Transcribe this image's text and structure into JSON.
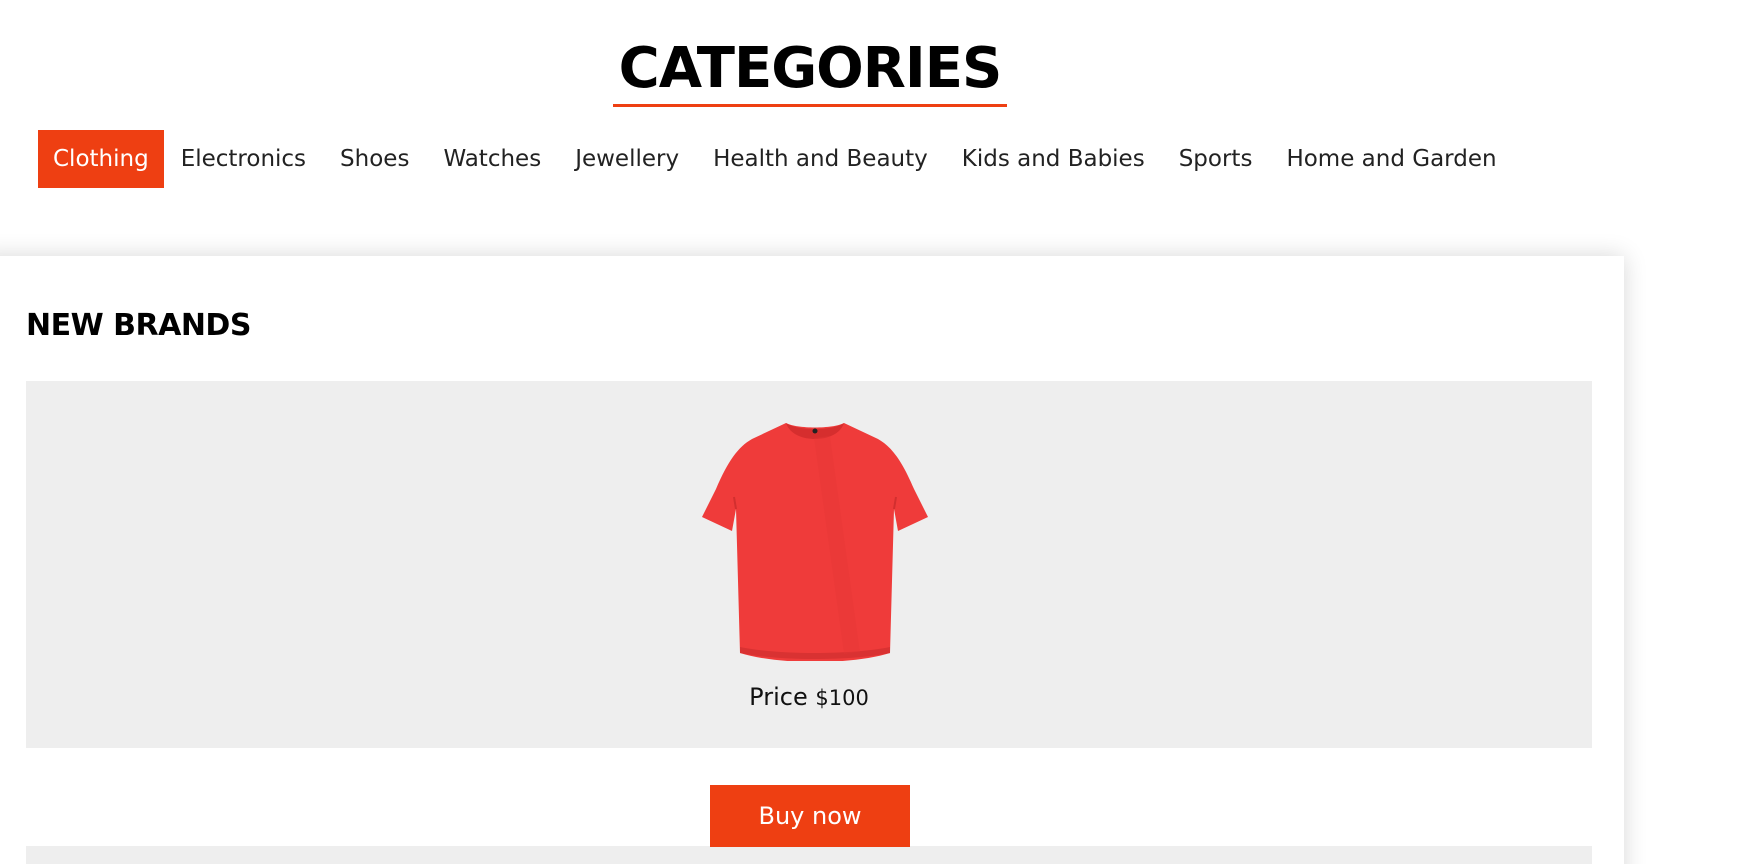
{
  "header": {
    "title": "CATEGORIES"
  },
  "categories": {
    "active_index": 0,
    "items": [
      {
        "label": "Clothing"
      },
      {
        "label": "Electronics"
      },
      {
        "label": "Shoes"
      },
      {
        "label": "Watches"
      },
      {
        "label": "Jewellery"
      },
      {
        "label": "Health and Beauty"
      },
      {
        "label": "Kids and Babies"
      },
      {
        "label": "Sports"
      },
      {
        "label": "Home and Garden"
      }
    ]
  },
  "section": {
    "title": "NEW BRANDS"
  },
  "product": {
    "image_icon": "red-tshirt",
    "price_label": "Price",
    "price_value": "$100",
    "buy_label": "Buy now"
  },
  "colors": {
    "accent": "#ee3f12",
    "panel_background": "#eeeeee",
    "tshirt_red": "#ef3b3a"
  }
}
